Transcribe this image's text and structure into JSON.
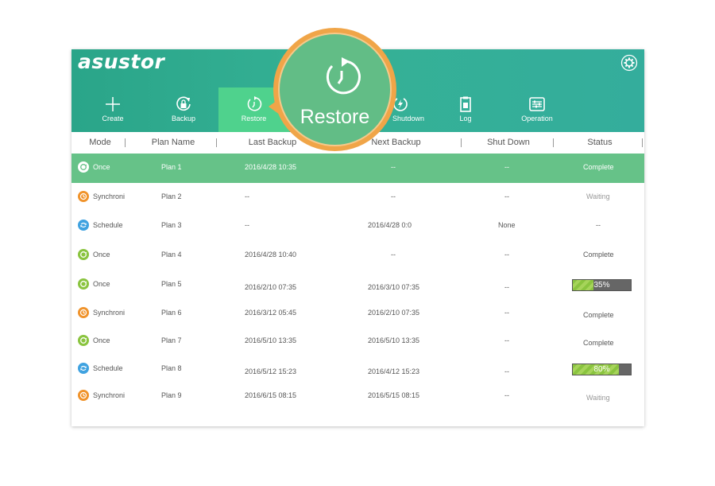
{
  "brand": "asustor",
  "toolbar": [
    {
      "label": "Create",
      "icon": "plus-icon"
    },
    {
      "label": "Backup",
      "icon": "backup-icon"
    },
    {
      "label": "Restore",
      "icon": "restore-icon"
    },
    {
      "label": "Shutdown",
      "icon": "shutdown-icon"
    },
    {
      "label": "Log",
      "icon": "log-icon"
    },
    {
      "label": "Operation",
      "icon": "operation-icon"
    }
  ],
  "columns": [
    "Mode",
    "Plan Name",
    "Last Backup",
    "Next Backup",
    "Shut Down",
    "Status"
  ],
  "rows": [
    {
      "mode": "Once",
      "mode_icon": "once-icon",
      "plan": "Plan 1",
      "last": "2016/4/28 10:35",
      "next": "--",
      "shutdown": "--",
      "status": "Complete",
      "progress": null
    },
    {
      "mode": "Synchroni",
      "mode_icon": "sync-icon",
      "plan": "Plan 2",
      "last": "--",
      "next": "--",
      "shutdown": "--",
      "status": "Waiting",
      "progress": null
    },
    {
      "mode": "Schedule",
      "mode_icon": "schedule-icon",
      "plan": "Plan 3",
      "last": "--",
      "next": "2016/4/28 0:0",
      "shutdown": "None",
      "status": "--",
      "progress": null
    },
    {
      "mode": "Once",
      "mode_icon": "once-icon",
      "plan": "Plan 4",
      "last": "2016/4/28 10:40",
      "next": "--",
      "shutdown": "--",
      "status": "Complete",
      "progress": null
    },
    {
      "mode": "Once",
      "mode_icon": "once-icon",
      "plan": "Plan 5",
      "last": "2016/2/10 07:35",
      "next": "2016/3/10 07:35",
      "shutdown": "--",
      "status": "35%",
      "progress": 0.35
    },
    {
      "mode": "Synchroni",
      "mode_icon": "sync-icon",
      "plan": "Plan 6",
      "last": "2016/3/12  05:45",
      "next": "2016/2/10 07:35",
      "shutdown": "--",
      "status": "Complete",
      "progress": null
    },
    {
      "mode": "Once",
      "mode_icon": "once-icon",
      "plan": "Plan 7",
      "last": "2016/5/10 13:35",
      "next": "2016/5/10 13:35",
      "shutdown": "--",
      "status": "Complete",
      "progress": null
    },
    {
      "mode": "Schedule",
      "mode_icon": "schedule-icon",
      "plan": "Plan 8",
      "last": "2016/5/12 15:23",
      "next": "2016/4/12 15:23",
      "shutdown": "--",
      "status": "80%",
      "progress": 0.8
    },
    {
      "mode": "Synchroni",
      "mode_icon": "sync-icon",
      "plan": "Plan 9",
      "last": "2016/6/15  08:15",
      "next": "2016/5/15 08:15",
      "shutdown": "--",
      "status": "Waiting",
      "progress": null
    }
  ],
  "callout": {
    "label": "Restore",
    "icon": "restore-icon"
  },
  "colors": {
    "header": "#2aa589",
    "active_tab": "#4fd28d",
    "selected_row": "#66c288",
    "callout_ring": "#f0a548",
    "progress": "#8ac43f"
  }
}
